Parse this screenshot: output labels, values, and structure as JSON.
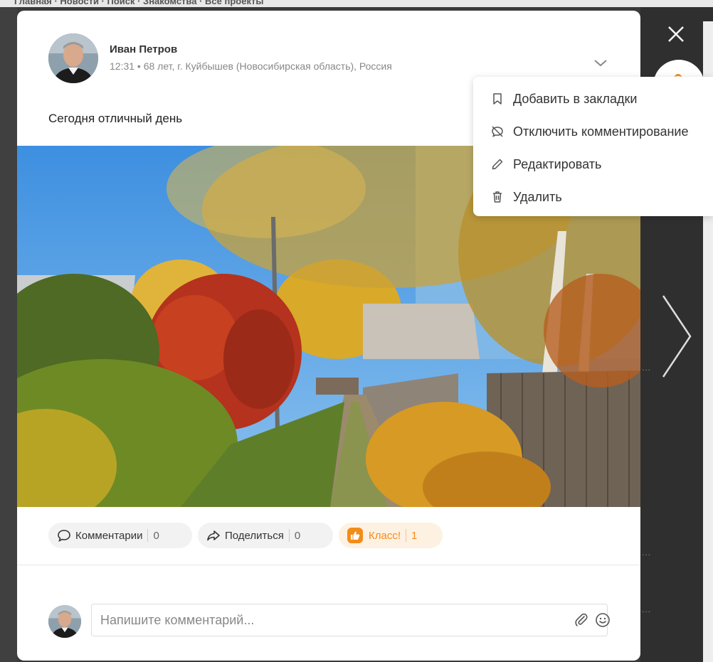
{
  "background": {
    "top_strip_text": "Главная · Новости · Поиск · Знакомства · Все проекты"
  },
  "post": {
    "author": {
      "name": "Иван Петров",
      "meta": "12:31 • 68 лет, г. Куйбышев (Новосибирская область), Россия"
    },
    "text": "Сегодня отличный день",
    "photo_icon": "autumn-village-photo"
  },
  "menu": {
    "items": [
      {
        "label": "Добавить в закладки",
        "icon": "bookmark-icon"
      },
      {
        "label": "Отключить комментирование",
        "icon": "comments-off-icon"
      },
      {
        "label": "Редактировать",
        "icon": "pencil-icon"
      },
      {
        "label": "Удалить",
        "icon": "trash-icon"
      }
    ]
  },
  "actions": {
    "comments": {
      "label": "Комментарии",
      "count": "0"
    },
    "share": {
      "label": "Поделиться",
      "count": "0"
    },
    "like": {
      "label": "Класс!",
      "count": "1"
    }
  },
  "comment_box": {
    "placeholder": "Напишите комментарий..."
  },
  "colors": {
    "accent": "#f28c1b",
    "overlay": "#3a3a3a"
  }
}
